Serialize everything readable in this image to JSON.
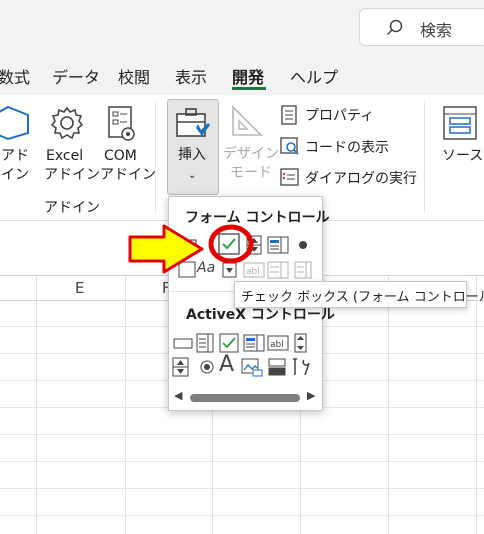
{
  "search": {
    "label": "検索"
  },
  "tabs": [
    {
      "label": "数式"
    },
    {
      "label": "データ"
    },
    {
      "label": "校閲"
    },
    {
      "label": "表示"
    },
    {
      "label": "開発",
      "active": true
    },
    {
      "label": "ヘルプ"
    }
  ],
  "ribbon": {
    "addin_button_line1": "アド",
    "addin_button_line2": "イン",
    "excel_addin_line1": "Excel",
    "excel_addin_line2": "アドイン",
    "com_addin_line1": "COM",
    "com_addin_line2": "アドイン",
    "addin_group_label": "アドイン",
    "insert_label": "挿入",
    "design_mode_line1": "デザイン",
    "design_mode_line2": "モード",
    "properties_label": "プロパティ",
    "view_code_label": "コードの表示",
    "run_dialog_label": "ダイアログの実行",
    "source_label": "ソース"
  },
  "dropdown": {
    "form_controls_header": "フォーム コントロール",
    "activex_header": "ActiveX コントロール"
  },
  "tooltip": {
    "text": "チェック ボックス (フォーム コントロール)"
  },
  "columns": [
    "E",
    "F"
  ],
  "colors": {
    "accent": "#217346",
    "arrow_fill": "#ffff00",
    "arrow_stroke": "#e00000",
    "highlight_circle": "#e00000"
  }
}
